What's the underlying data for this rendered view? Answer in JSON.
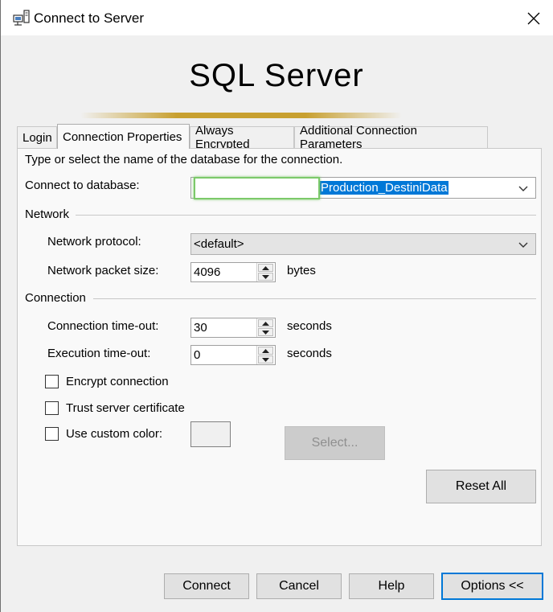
{
  "window": {
    "title": "Connect to Server"
  },
  "banner": {
    "product": "SQL Server"
  },
  "tabs": [
    {
      "label": "Login",
      "active": false
    },
    {
      "label": "Connection Properties",
      "active": true
    },
    {
      "label": "Always Encrypted",
      "active": false
    },
    {
      "label": "Additional Connection Parameters",
      "active": false
    }
  ],
  "panel": {
    "instructions": "Type or select the name of the database for the connection.",
    "database": {
      "label": "Connect to database:",
      "value": "Production_DestiniData"
    },
    "network": {
      "section": "Network",
      "protocol_label": "Network protocol:",
      "protocol_value": "<default>",
      "packet_label": "Network packet size:",
      "packet_value": "4096",
      "packet_unit": "bytes"
    },
    "connection": {
      "section": "Connection",
      "timeout_label": "Connection time-out:",
      "timeout_value": "30",
      "timeout_unit": "seconds",
      "exec_label": "Execution time-out:",
      "exec_value": "0",
      "exec_unit": "seconds",
      "encrypt_label": "Encrypt connection",
      "encrypt_checked": false,
      "trust_label": "Trust server certificate",
      "trust_checked": false,
      "color_label": "Use custom color:",
      "color_checked": false,
      "select_label": "Select..."
    },
    "reset_label": "Reset All"
  },
  "footer": {
    "connect": "Connect",
    "cancel": "Cancel",
    "help": "Help",
    "options": "Options <<"
  },
  "icons": {
    "title": "server-connect-icon",
    "close": "close-icon",
    "dropdown": "chevron-down-icon",
    "spin_up": "spin-up-icon",
    "spin_down": "spin-down-icon"
  },
  "colors": {
    "selection": "#0078d7",
    "default_button_border": "#0078d7",
    "focus": "#7cc96a"
  }
}
